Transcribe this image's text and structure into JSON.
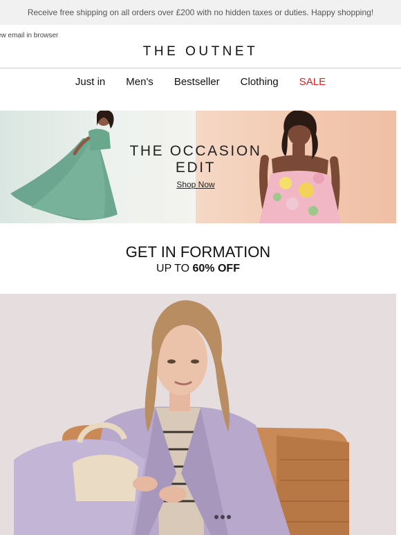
{
  "topbar": {
    "text": "Receive free shipping on all orders over £200 with no hidden taxes or duties. Happy shopping!"
  },
  "header": {
    "view_in_browser": "ew email in browser",
    "logo": "THE OUTNET"
  },
  "nav": {
    "items": [
      "Just in",
      "Men's",
      "Bestseller",
      "Clothing",
      "SALE"
    ]
  },
  "hero": {
    "title_line1": "THE OCCASION",
    "title_line2": "EDIT",
    "cta": "Shop Now"
  },
  "promo": {
    "title": "GET IN FORMATION",
    "sub_prefix": "UP TO ",
    "sub_bold": "60% OFF"
  },
  "colors": {
    "sale": "#e02020",
    "topbar_bg": "#f1f1f1"
  }
}
